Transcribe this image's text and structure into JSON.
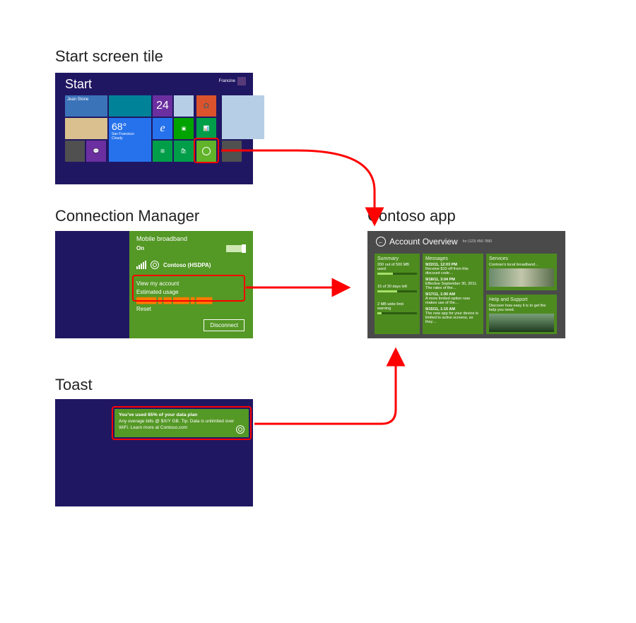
{
  "labels": {
    "start_tile": "Start screen tile",
    "connection_manager": "Connection Manager",
    "toast": "Toast",
    "contoso_app": "Contoso app"
  },
  "start": {
    "title": "Start",
    "user_name": "Francine",
    "tiles": {
      "calendar_number": "24",
      "weather_temp": "68°",
      "weather_city": "San Francisco",
      "weather_cond": "Cloudy",
      "user_tile": "Jean Stone"
    }
  },
  "conn": {
    "heading": "Mobile broadband",
    "state": "On",
    "network_name": "Contoso (HSDPA)",
    "items": {
      "view_account": "View my account",
      "estimated_usage": "Estimated usage",
      "reset": "Reset"
    },
    "disconnect": "Disconnect"
  },
  "toast": {
    "title": "You've used 65% of your data plan",
    "body": "Any overage bills @ $X/Y GB. Tip: Data is unlimited over WiFi. Learn more at Contoso.com"
  },
  "app": {
    "header": "Account Overview",
    "phone": "for (123) 456-7890",
    "summary": {
      "title": "Summary",
      "line1": "200 out of 500 MB used",
      "line2": "15 of 30 days left",
      "line3": "2 MB wide limit warning"
    },
    "messages": {
      "title": "Messages",
      "m1_t": "9/22/11, 12:03 PM",
      "m1_b": "Receive $10 off from this discount code…",
      "m2_t": "9/18/11, 3:04 PM",
      "m2_b": "Effective September 30, 2011. The rates of the…",
      "m3_t": "9/17/11, 1:00 AM",
      "m3_b": "A more limited option now makes use of the…",
      "m4_t": "9/15/11, 1:15 AM",
      "m4_b": "The new app for your device is limited to active screens, so they…"
    },
    "services": {
      "title": "Services",
      "body": "Contoso's local broadband…"
    },
    "help": {
      "title": "Help and Support",
      "body": "Discover how easy it is to get the help you need."
    }
  }
}
